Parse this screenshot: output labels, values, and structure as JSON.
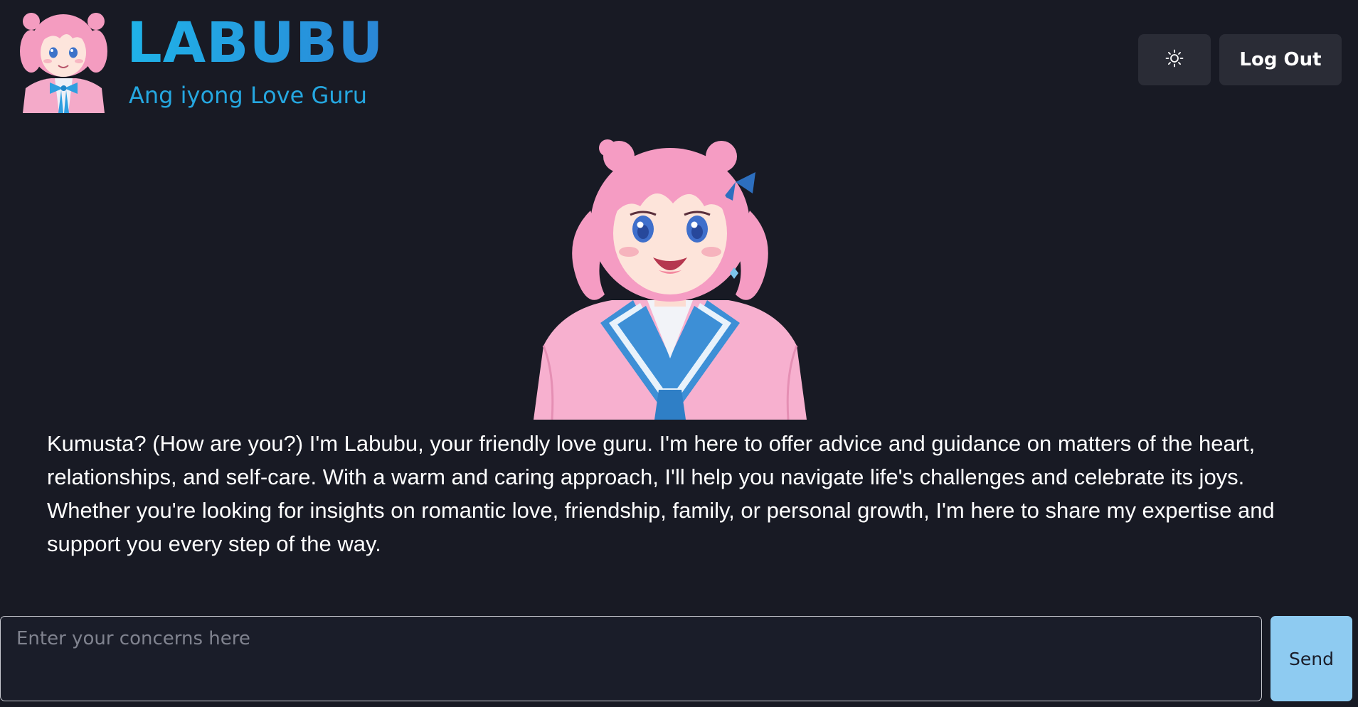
{
  "header": {
    "title": "LABUBU",
    "subtitle": "Ang iyong Love Guru",
    "logo_icon": "anime-girl-avatar-icon",
    "theme_toggle_icon": "sun-icon",
    "logout_label": "Log Out"
  },
  "hero": {
    "image_icon": "anime-girl-portrait-icon"
  },
  "message": {
    "text": "Kumusta? (How are you?) I'm Labubu, your friendly love guru. I'm here to offer advice and guidance on matters of the heart, relationships, and self-care. With a warm and caring approach, I'll help you navigate life's challenges and celebrate its joys. Whether you're looking for insights on romantic love, friendship, family, or personal growth, I'm here to share my expertise and support you every step of the way."
  },
  "composer": {
    "placeholder": "Enter your concerns here",
    "value": "",
    "send_label": "Send"
  },
  "colors": {
    "background": "#181a24",
    "brand": "#1ea9e6",
    "button_bg": "#2a2c36",
    "send_bg": "#8ecbf1",
    "hair": "#f4a6c6",
    "uniform": "#f7b2d0",
    "tie": "#2d7fc7"
  }
}
